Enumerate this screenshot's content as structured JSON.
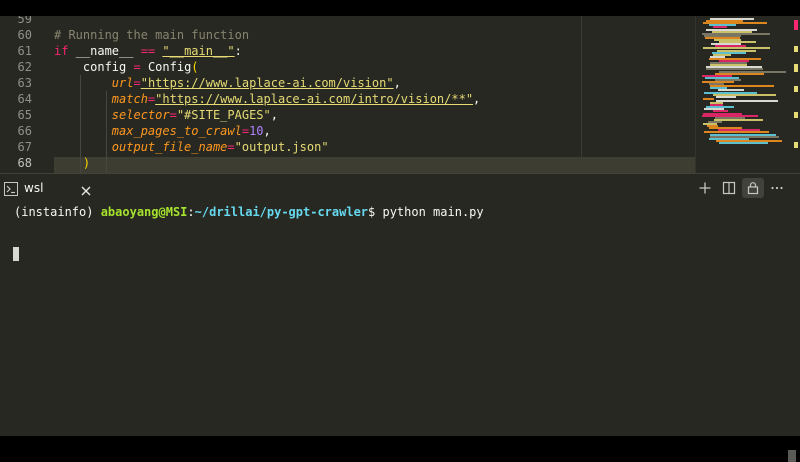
{
  "editor": {
    "lines": [
      {
        "number": "59",
        "tokens": []
      },
      {
        "number": "60",
        "tokens": [
          {
            "t": "# Running the main function",
            "c": "tok-comment"
          }
        ]
      },
      {
        "number": "61",
        "tokens": [
          {
            "t": "if",
            "c": "tok-kw"
          },
          {
            "t": " __name__ ",
            "c": "tok-plain"
          },
          {
            "t": "==",
            "c": "tok-op"
          },
          {
            "t": " ",
            "c": "tok-plain"
          },
          {
            "t": "\"__main__\"",
            "c": "tok-str"
          },
          {
            "t": ":",
            "c": "tok-plain"
          }
        ]
      },
      {
        "number": "62",
        "tokens": [
          {
            "t": "    config ",
            "c": "tok-plain"
          },
          {
            "t": "=",
            "c": "tok-op"
          },
          {
            "t": " Config",
            "c": "tok-plain"
          },
          {
            "t": "(",
            "c": "tok-paren"
          }
        ]
      },
      {
        "number": "63",
        "tokens": [
          {
            "t": "        ",
            "c": "tok-plain"
          },
          {
            "t": "url",
            "c": "tok-param"
          },
          {
            "t": "=",
            "c": "tok-op"
          },
          {
            "t": "\"https://www.laplace-ai.com/vision\"",
            "c": "tok-str"
          },
          {
            "t": ",",
            "c": "tok-plain"
          }
        ]
      },
      {
        "number": "64",
        "tokens": [
          {
            "t": "        ",
            "c": "tok-plain"
          },
          {
            "t": "match",
            "c": "tok-param"
          },
          {
            "t": "=",
            "c": "tok-op"
          },
          {
            "t": "\"https://www.laplace-ai.com/intro/vision/**\"",
            "c": "tok-str"
          },
          {
            "t": ",",
            "c": "tok-plain"
          }
        ]
      },
      {
        "number": "65",
        "tokens": [
          {
            "t": "        ",
            "c": "tok-plain"
          },
          {
            "t": "selector",
            "c": "tok-param"
          },
          {
            "t": "=",
            "c": "tok-op"
          },
          {
            "t": "\"#SITE_PAGES\"",
            "c": "tok-str-plain"
          },
          {
            "t": ",",
            "c": "tok-plain"
          }
        ]
      },
      {
        "number": "66",
        "tokens": [
          {
            "t": "        ",
            "c": "tok-plain"
          },
          {
            "t": "max_pages_to_crawl",
            "c": "tok-param"
          },
          {
            "t": "=",
            "c": "tok-op"
          },
          {
            "t": "10",
            "c": "tok-num"
          },
          {
            "t": ",",
            "c": "tok-plain"
          }
        ]
      },
      {
        "number": "67",
        "tokens": [
          {
            "t": "        ",
            "c": "tok-plain"
          },
          {
            "t": "output_file_name",
            "c": "tok-param"
          },
          {
            "t": "=",
            "c": "tok-op"
          },
          {
            "t": "\"output.json\"",
            "c": "tok-str-plain"
          }
        ]
      },
      {
        "number": "68",
        "tokens": [
          {
            "t": "    ",
            "c": "tok-plain"
          },
          {
            "t": ")",
            "c": "tok-paren"
          }
        ]
      }
    ]
  },
  "panel": {
    "tab_label": "wsl",
    "tab_icon": "terminal-icon",
    "actions": [
      "new-terminal-icon",
      "split-terminal-icon",
      "lock-icon",
      "more-actions-icon"
    ]
  },
  "terminal": {
    "env": "(instainfo) ",
    "user_host": "abaoyang@MSI",
    "colon": ":",
    "path": "~/drillai/py-gpt-crawler",
    "prompt_symbol": "$ ",
    "command": "python main.py"
  },
  "colors": {
    "background": "#272822",
    "keyword": "#f92672",
    "string": "#e6db74",
    "parameter": "#fd971f",
    "number": "#ae81ff",
    "comment": "#88846f",
    "prompt_user": "#a6e22e",
    "prompt_path": "#66d9ef"
  }
}
